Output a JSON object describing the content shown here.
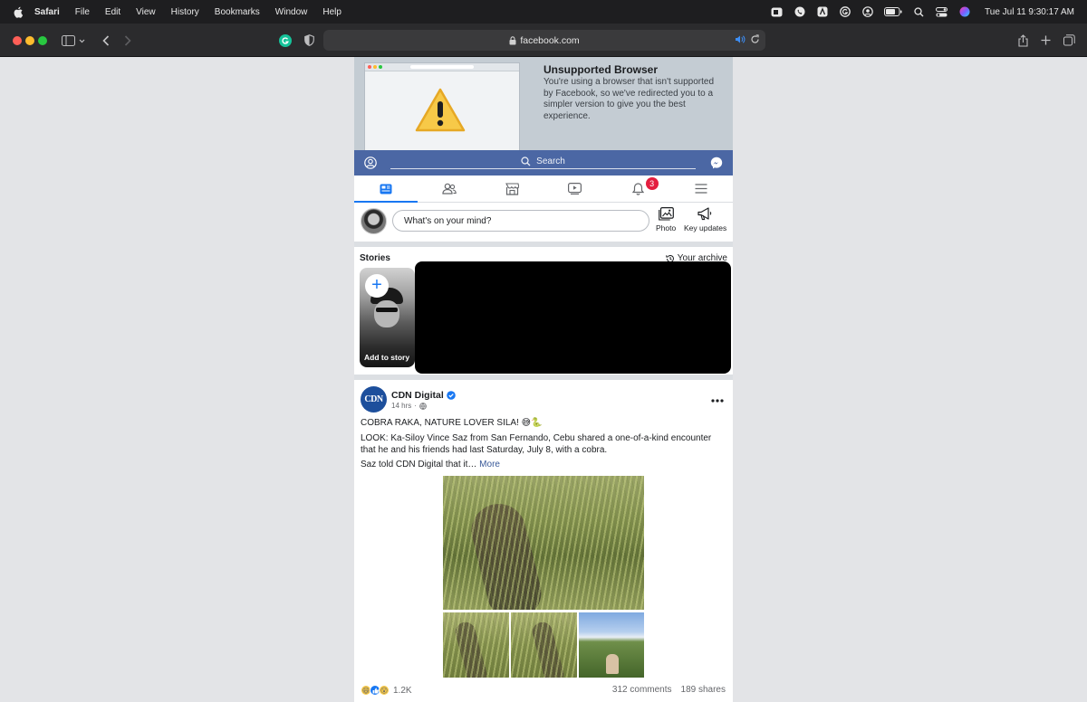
{
  "menubar": {
    "app": "Safari",
    "items": [
      "File",
      "Edit",
      "View",
      "History",
      "Bookmarks",
      "Window",
      "Help"
    ],
    "clock": "Tue Jul 11  9:30:17 AM"
  },
  "browser": {
    "url": "facebook.com"
  },
  "banner": {
    "title": "Unsupported Browser",
    "text": "You're using a browser that isn't supported by Facebook, so we've redirected you to a simpler version to give you the best experience."
  },
  "fb": {
    "search_label": "Search",
    "notification_count": "3",
    "composer": {
      "placeholder": "What's on your mind?",
      "photo_label": "Photo",
      "key_updates_label": "Key updates"
    },
    "stories": {
      "title": "Stories",
      "archive": "Your archive",
      "add_label": "Add to story"
    },
    "post": {
      "logo_text": "CDN",
      "page_name": "CDN Digital",
      "time": "14 hrs",
      "headline": "COBRA RAKA, NATURE LOVER SILA! 😅🐍",
      "body": "LOOK: Ka-Siloy Vince Saz from San Fernando, Cebu shared a one-of-a-kind encounter that he and his friends had last Saturday, July 8, with a cobra.",
      "teaser": "Saz told CDN Digital that it…",
      "more": "More",
      "reactions": "1.2K",
      "comments": "312 comments",
      "shares": "189 shares"
    }
  },
  "colors": {
    "fb_blue_bar": "#4b67a4",
    "accent": "#1877f2",
    "badge": "#e41e3f"
  }
}
